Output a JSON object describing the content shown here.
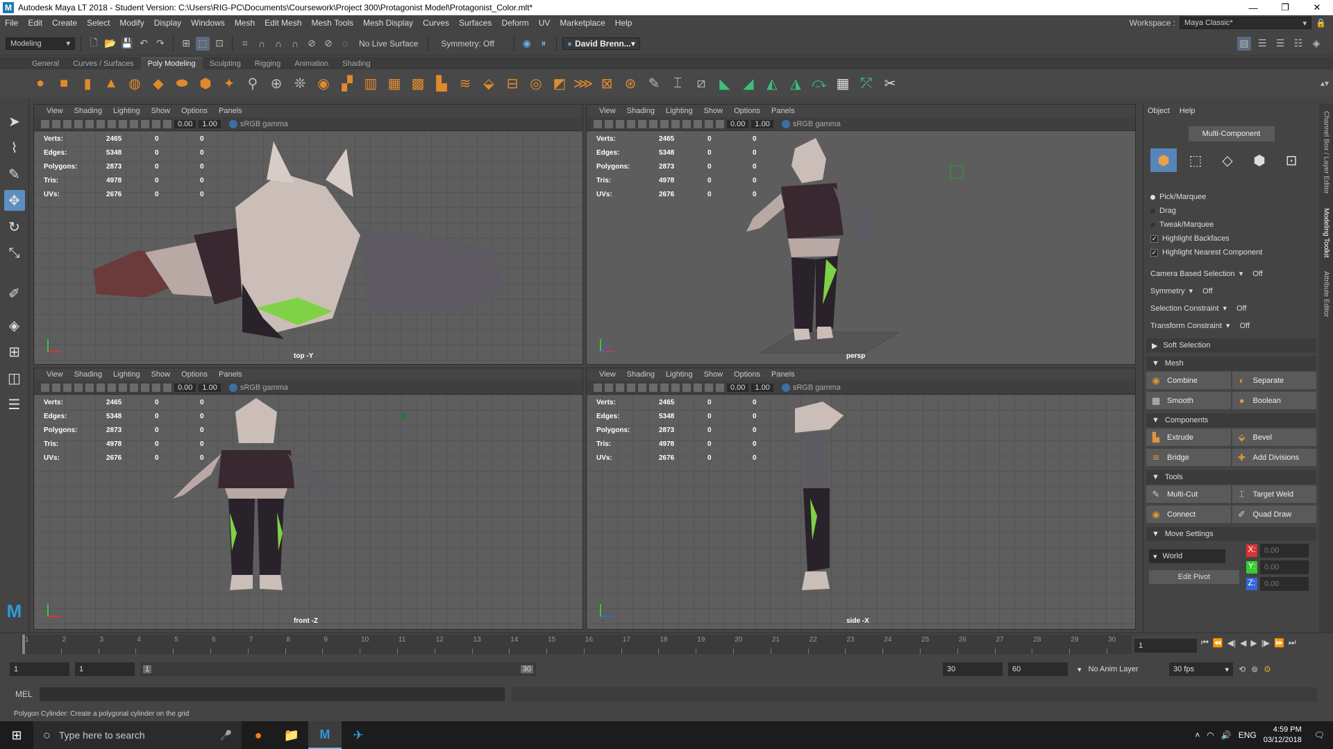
{
  "window": {
    "title": "Autodesk Maya LT 2018 - Student Version: C:\\Users\\RIG-PC\\Documents\\Coursework\\Project 300\\Protagonist Model\\Protagonist_Color.mlt*",
    "minimize": "—",
    "maximize": "❐",
    "close": "✕"
  },
  "menu": [
    "File",
    "Edit",
    "Create",
    "Select",
    "Modify",
    "Display",
    "Windows",
    "Mesh",
    "Edit Mesh",
    "Mesh Tools",
    "Mesh Display",
    "Curves",
    "Surfaces",
    "Deform",
    "UV",
    "Marketplace",
    "Help"
  ],
  "workspace": {
    "label": "Workspace :",
    "value": "Maya Classic*"
  },
  "status": {
    "mode": "Modeling",
    "live_surface": "No Live Surface",
    "symmetry": "Symmetry: Off",
    "user": "David Brenn..."
  },
  "shelf_tabs": [
    "General",
    "Curves / Surfaces",
    "Poly Modeling",
    "Sculpting",
    "Rigging",
    "Animation",
    "Shading"
  ],
  "shelf_active": "Poly Modeling",
  "viewport_menu": [
    "View",
    "Shading",
    "Lighting",
    "Show",
    "Options",
    "Panels"
  ],
  "viewport_fields": {
    "a": "0.00",
    "b": "1.00",
    "gamma": "sRGB gamma"
  },
  "hud": [
    {
      "label": "Verts:",
      "value": "2465",
      "s1": "0",
      "s2": "0"
    },
    {
      "label": "Edges:",
      "value": "5348",
      "s1": "0",
      "s2": "0"
    },
    {
      "label": "Polygons:",
      "value": "2873",
      "s1": "0",
      "s2": "0"
    },
    {
      "label": "Tris:",
      "value": "4978",
      "s1": "0",
      "s2": "0"
    },
    {
      "label": "UVs:",
      "value": "2676",
      "s1": "0",
      "s2": "0"
    }
  ],
  "viewports": {
    "top": "top -Y",
    "persp": "persp",
    "front": "front -Z",
    "side": "side -X"
  },
  "modeling_toolkit": {
    "tabs": [
      "Object",
      "Help"
    ],
    "mode": "Multi-Component",
    "options": {
      "pick": "Pick/Marquee",
      "drag": "Drag",
      "tweak": "Tweak/Marquee",
      "backfaces": "Highlight Backfaces",
      "nearest": "Highlight Nearest Component"
    },
    "settings": [
      {
        "label": "Camera Based Selection",
        "value": "Off"
      },
      {
        "label": "Symmetry",
        "value": "Off"
      },
      {
        "label": "Selection Constraint",
        "value": "Off"
      },
      {
        "label": "Transform Constraint",
        "value": "Off"
      }
    ],
    "soft_selection": "Soft Selection",
    "mesh": {
      "title": "Mesh",
      "buttons": [
        "Combine",
        "Separate",
        "Smooth",
        "Boolean"
      ]
    },
    "components": {
      "title": "Components",
      "buttons": [
        "Extrude",
        "Bevel",
        "Bridge",
        "Add Divisions"
      ]
    },
    "tools": {
      "title": "Tools",
      "buttons": [
        "Multi-Cut",
        "Target Weld",
        "Connect",
        "Quad Draw"
      ]
    },
    "move_settings": {
      "title": "Move Settings",
      "space": "World",
      "edit_pivot": "Edit Pivot",
      "x": "0.00",
      "y": "0.00",
      "z": "0.00"
    }
  },
  "side_tabs": [
    "Channel Box / Layer Editor",
    "Modeling Toolkit",
    "Attribute Editor"
  ],
  "timeline": {
    "ticks": [
      "1",
      "2",
      "3",
      "4",
      "5",
      "6",
      "7",
      "8",
      "9",
      "10",
      "11",
      "12",
      "13",
      "14",
      "15",
      "16",
      "17",
      "18",
      "19",
      "20",
      "21",
      "22",
      "23",
      "24",
      "25",
      "26",
      "27",
      "28",
      "29",
      "30"
    ],
    "current": "1"
  },
  "range": {
    "start": "1",
    "inner_start": "1",
    "slider_start": "1",
    "slider_end": "30",
    "end": "30",
    "outer_end": "60",
    "anim_layer": "No Anim Layer",
    "fps": "30 fps"
  },
  "mel": {
    "label": "MEL"
  },
  "help_line": "Polygon Cylinder: Create a polygonal cylinder on the grid",
  "taskbar": {
    "search_placeholder": "Type here to search",
    "lang": "ENG",
    "time": "4:59 PM",
    "date": "03/12/2018"
  }
}
